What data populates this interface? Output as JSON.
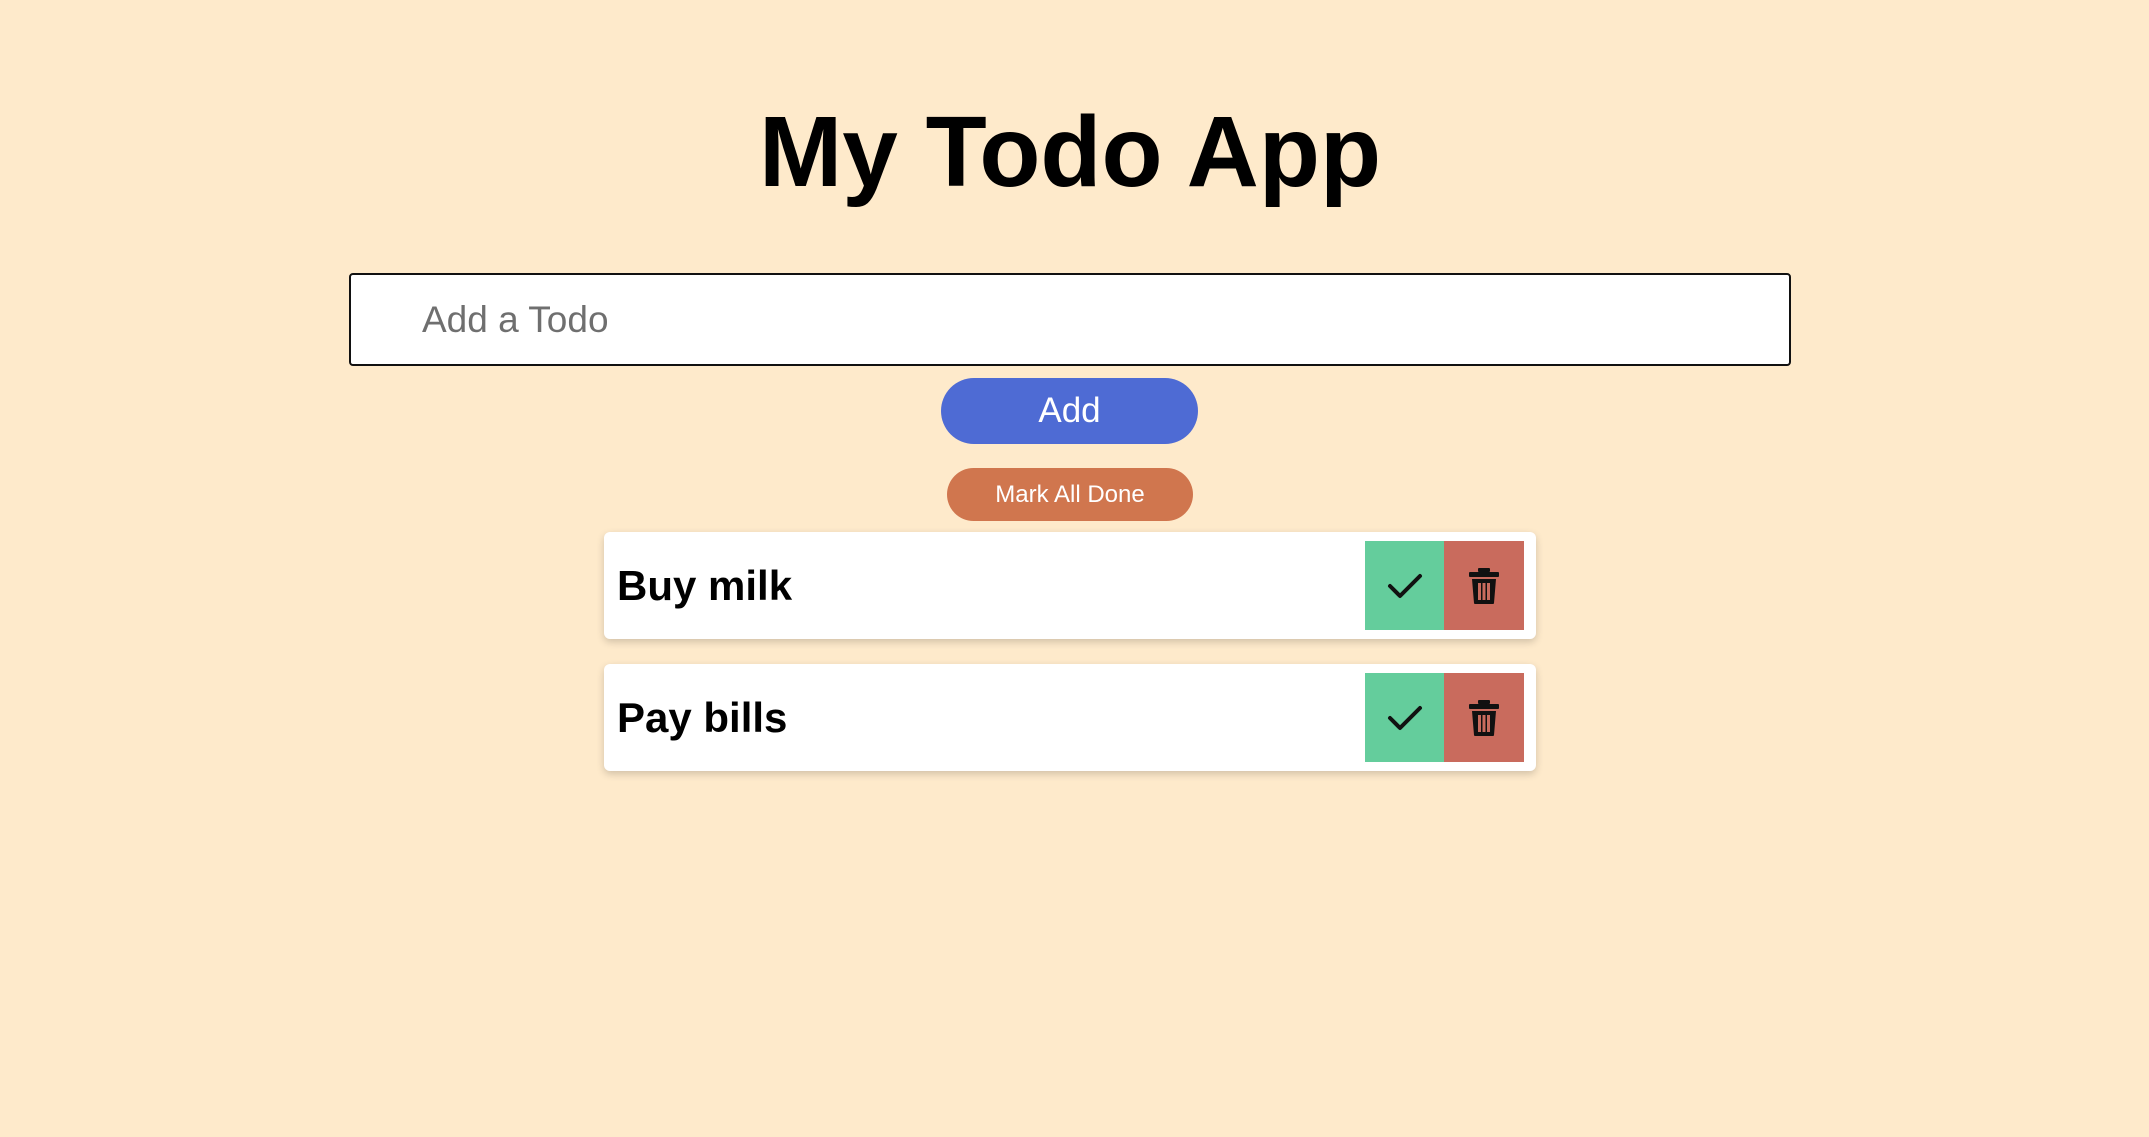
{
  "header": {
    "title": "My Todo App"
  },
  "input": {
    "placeholder": "Add a Todo",
    "value": ""
  },
  "buttons": {
    "add_label": "Add",
    "mark_all_label": "Mark All Done"
  },
  "todos": [
    {
      "text": "Buy milk",
      "done_icon": "check-icon",
      "delete_icon": "trash-icon"
    },
    {
      "text": "Pay bills",
      "done_icon": "check-icon",
      "delete_icon": "trash-icon"
    }
  ],
  "colors": {
    "background": "#feeacb",
    "add_button": "#4e6bd4",
    "mark_all_button": "#d0764e",
    "done_button": "#64cd9c",
    "delete_button": "#c96b5d"
  }
}
